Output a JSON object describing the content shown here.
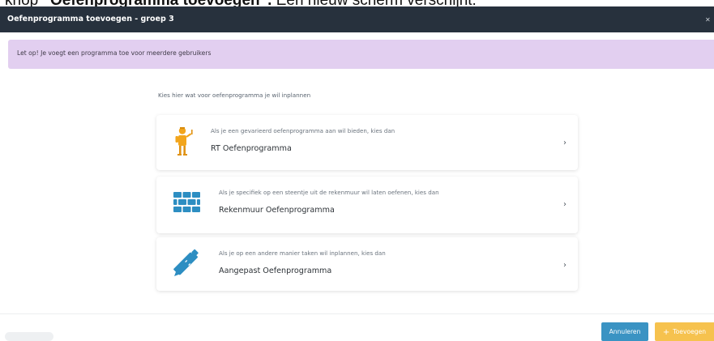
{
  "doc_text": {
    "prefix": "knop",
    "bold": "“Oefenprogramma toevoegen”.",
    "suffix": "Een nieuw scherm verschijnt:"
  },
  "modal": {
    "title": "Oefenprogramma toevoegen - groep 3"
  },
  "alert": {
    "text": "Let op! Je voegt een programma toe voor meerdere gebruikers"
  },
  "intro": "Kies hier wat voor oefenprogramma je wil inplannen",
  "options": [
    {
      "description": "Als je een gevarieerd oefenprogramma aan wil bieden, kies dan",
      "title": "RT Oefenprogramma",
      "icon": "figure-icon"
    },
    {
      "description": "Als je specifiek op een steentje uit de rekenmuur wil laten oefenen, kies dan",
      "title": "Rekenmuur Oefenprogramma",
      "icon": "brick-wall-icon"
    },
    {
      "description": "Als je op een andere manier taken wil inplannen, kies dan",
      "title": "Aangepast Oefenprogramma",
      "icon": "pencil-ruler-icon"
    }
  ],
  "buttons": {
    "cancel": "Annuleren",
    "add": "Toevoegen"
  },
  "colors": {
    "header": "#27313d",
    "alert": "#e2cff0",
    "icon_blue": "#2d8ec2",
    "icon_orange": "#f2a51c",
    "cancel": "#3a93c3",
    "add": "#f6c24e"
  }
}
